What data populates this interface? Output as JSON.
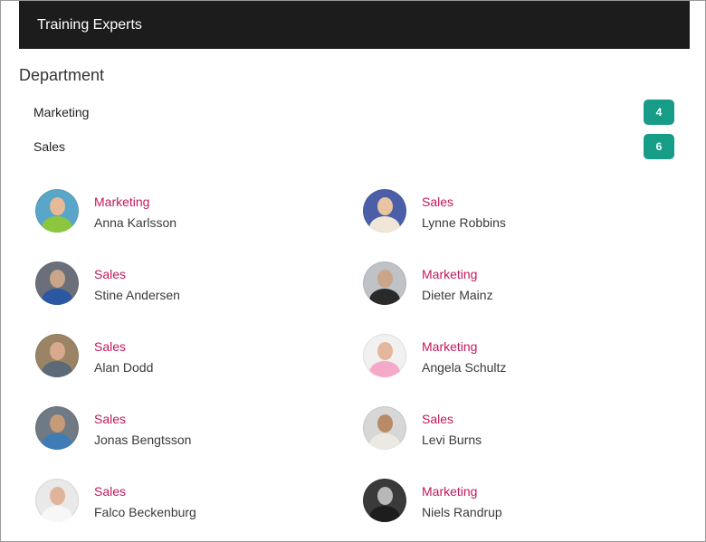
{
  "header": {
    "title": "Training Experts"
  },
  "filters": {
    "title": "Department",
    "items": [
      {
        "label": "Marketing",
        "count": "4"
      },
      {
        "label": "Sales",
        "count": "6"
      }
    ]
  },
  "experts": [
    {
      "department": "Marketing",
      "name": "Anna Karlsson",
      "avatar": {
        "bg": "#5aa6c8",
        "skin": "#e6b999",
        "cloth": "#8cc63f"
      }
    },
    {
      "department": "Sales",
      "name": "Lynne Robbins",
      "avatar": {
        "bg": "#4b5fa8",
        "skin": "#e9c4a3",
        "cloth": "#f0e6d8"
      }
    },
    {
      "department": "Sales",
      "name": "Stine Andersen",
      "avatar": {
        "bg": "#6a6f7a",
        "skin": "#caa58a",
        "cloth": "#2b57a3"
      }
    },
    {
      "department": "Marketing",
      "name": "Dieter Mainz",
      "avatar": {
        "bg": "#bfc3c7",
        "skin": "#caa58a",
        "cloth": "#2a2a2a"
      }
    },
    {
      "department": "Sales",
      "name": "Alan Dodd",
      "avatar": {
        "bg": "#9b8466",
        "skin": "#d8a98c",
        "cloth": "#5c6a78"
      }
    },
    {
      "department": "Marketing",
      "name": "Angela Schultz",
      "avatar": {
        "bg": "#f1f1f1",
        "skin": "#e3b79b",
        "cloth": "#f4a9c8"
      }
    },
    {
      "department": "Sales",
      "name": "Jonas Bengtsson",
      "avatar": {
        "bg": "#707a84",
        "skin": "#c79a78",
        "cloth": "#3f7bb5"
      }
    },
    {
      "department": "Sales",
      "name": "Levi Burns",
      "avatar": {
        "bg": "#d7d7d7",
        "skin": "#b98a66",
        "cloth": "#ece8e2"
      }
    },
    {
      "department": "Sales",
      "name": "Falco Beckenburg",
      "avatar": {
        "bg": "#e9e9e9",
        "skin": "#e0b49a",
        "cloth": "#f7f7f7"
      }
    },
    {
      "department": "Marketing",
      "name": "Niels Randrup",
      "avatar": {
        "bg": "#3a3a3a",
        "skin": "#b8b8b8",
        "cloth": "#1d1d1d"
      }
    }
  ],
  "colors": {
    "header_bg": "#1c1c1c",
    "badge_bg": "#169c87",
    "department_text": "#c2185b"
  }
}
